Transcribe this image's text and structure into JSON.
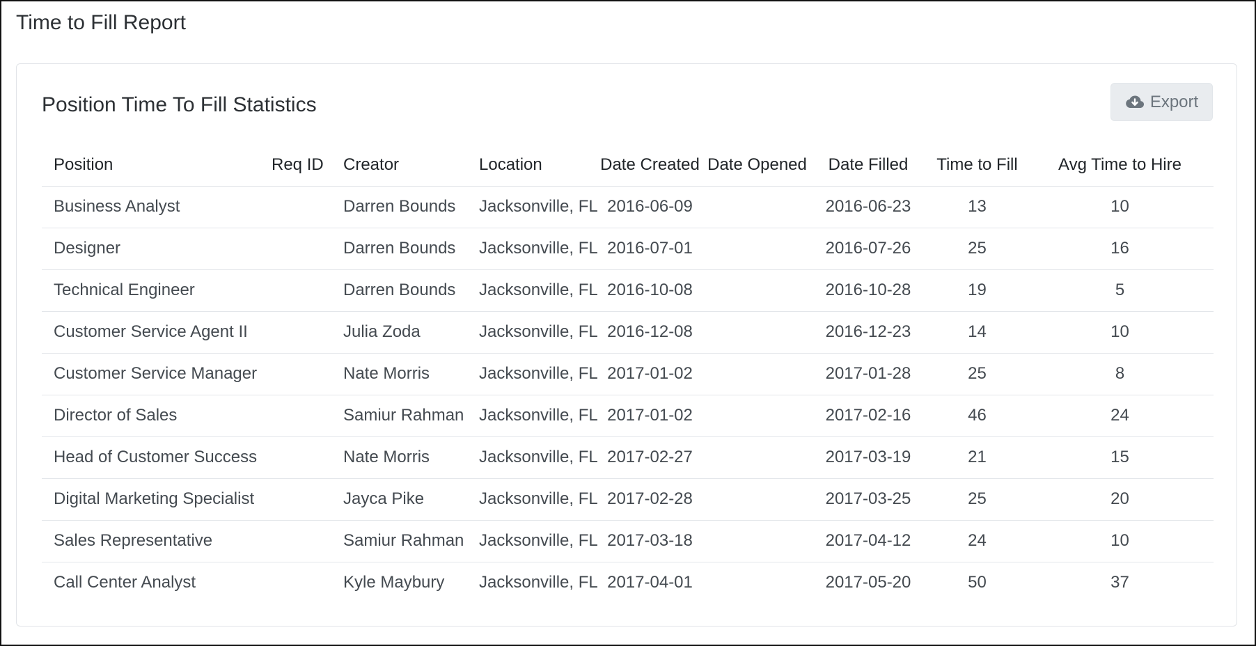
{
  "page": {
    "title": "Time to Fill Report"
  },
  "card": {
    "title": "Position Time To Fill Statistics",
    "export_label": "Export",
    "export_icon": "cloud-download-icon"
  },
  "table": {
    "headers": [
      "Position",
      "Req ID",
      "Creator",
      "Location",
      "Date Created",
      "Date Opened",
      "Date Filled",
      "Time to Fill",
      "Avg Time to Hire"
    ],
    "rows": [
      {
        "position": "Business Analyst",
        "req_id": "",
        "creator": "Darren Bounds",
        "location": "Jacksonville, FL",
        "date_created": "2016-06-09",
        "date_opened": "",
        "date_filled": "2016-06-23",
        "time_to_fill": "13",
        "avg_time_to_hire": "10"
      },
      {
        "position": "Designer",
        "req_id": "",
        "creator": "Darren Bounds",
        "location": "Jacksonville, FL",
        "date_created": "2016-07-01",
        "date_opened": "",
        "date_filled": "2016-07-26",
        "time_to_fill": "25",
        "avg_time_to_hire": "16"
      },
      {
        "position": "Technical Engineer",
        "req_id": "",
        "creator": "Darren Bounds",
        "location": "Jacksonville, FL",
        "date_created": "2016-10-08",
        "date_opened": "",
        "date_filled": "2016-10-28",
        "time_to_fill": "19",
        "avg_time_to_hire": "5"
      },
      {
        "position": "Customer Service Agent II",
        "req_id": "",
        "creator": "Julia Zoda",
        "location": "Jacksonville, FL",
        "date_created": "2016-12-08",
        "date_opened": "",
        "date_filled": "2016-12-23",
        "time_to_fill": "14",
        "avg_time_to_hire": "10"
      },
      {
        "position": "Customer Service Manager",
        "req_id": "",
        "creator": "Nate Morris",
        "location": "Jacksonville, FL",
        "date_created": "2017-01-02",
        "date_opened": "",
        "date_filled": "2017-01-28",
        "time_to_fill": "25",
        "avg_time_to_hire": "8"
      },
      {
        "position": "Director of Sales",
        "req_id": "",
        "creator": "Samiur Rahman",
        "location": "Jacksonville, FL",
        "date_created": "2017-01-02",
        "date_opened": "",
        "date_filled": "2017-02-16",
        "time_to_fill": "46",
        "avg_time_to_hire": "24"
      },
      {
        "position": "Head of Customer Success",
        "req_id": "",
        "creator": "Nate Morris",
        "location": "Jacksonville, FL",
        "date_created": "2017-02-27",
        "date_opened": "",
        "date_filled": "2017-03-19",
        "time_to_fill": "21",
        "avg_time_to_hire": "15"
      },
      {
        "position": "Digital Marketing Specialist",
        "req_id": "",
        "creator": "Jayca Pike",
        "location": "Jacksonville, FL",
        "date_created": "2017-02-28",
        "date_opened": "",
        "date_filled": "2017-03-25",
        "time_to_fill": "25",
        "avg_time_to_hire": "20"
      },
      {
        "position": "Sales Representative",
        "req_id": "",
        "creator": "Samiur Rahman",
        "location": "Jacksonville, FL",
        "date_created": "2017-03-18",
        "date_opened": "",
        "date_filled": "2017-04-12",
        "time_to_fill": "24",
        "avg_time_to_hire": "10"
      },
      {
        "position": "Call Center Analyst",
        "req_id": "",
        "creator": "Kyle Maybury",
        "location": "Jacksonville, FL",
        "date_created": "2017-04-01",
        "date_opened": "",
        "date_filled": "2017-05-20",
        "time_to_fill": "50",
        "avg_time_to_hire": "37"
      }
    ]
  }
}
